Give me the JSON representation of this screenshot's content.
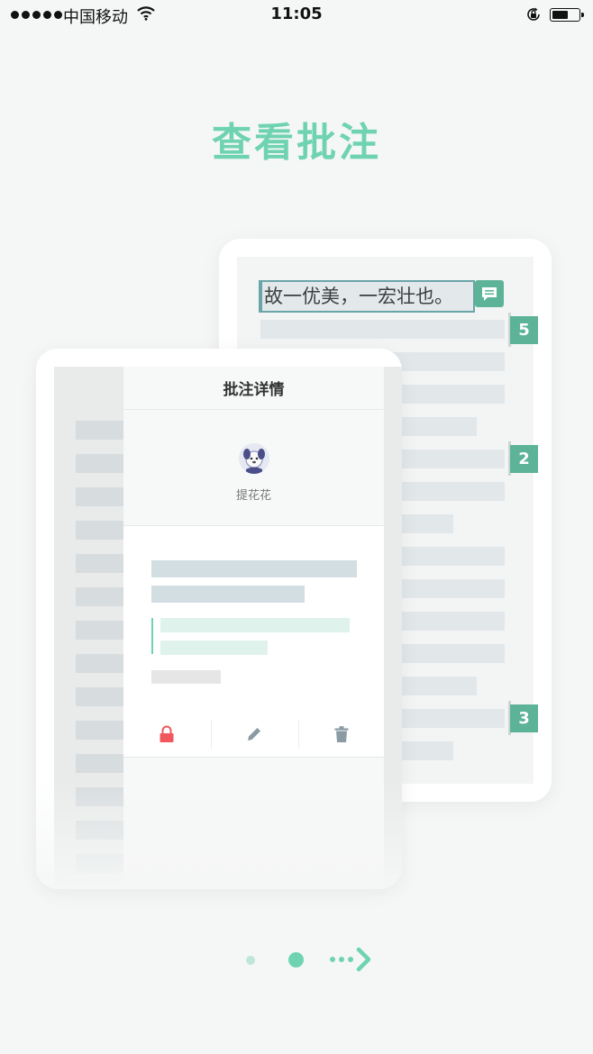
{
  "status_bar": {
    "carrier": "中国移动",
    "time": "11:05"
  },
  "onboarding": {
    "title": "查看批注",
    "back_card": {
      "quote_text": "故一优美，一宏壮也。",
      "badges": [
        "5",
        "2",
        "3"
      ]
    },
    "front_card": {
      "panel_title": "批注详情",
      "user_name": "提花花",
      "actions": [
        "lock-icon",
        "edit-icon",
        "delete-icon"
      ]
    }
  },
  "pager": {
    "total": 2,
    "current": 2
  },
  "colors": {
    "accent": "#6fd3b1",
    "badge": "#5cb398",
    "lock": "#f0585e",
    "action_icon": "#8a9ba3"
  }
}
